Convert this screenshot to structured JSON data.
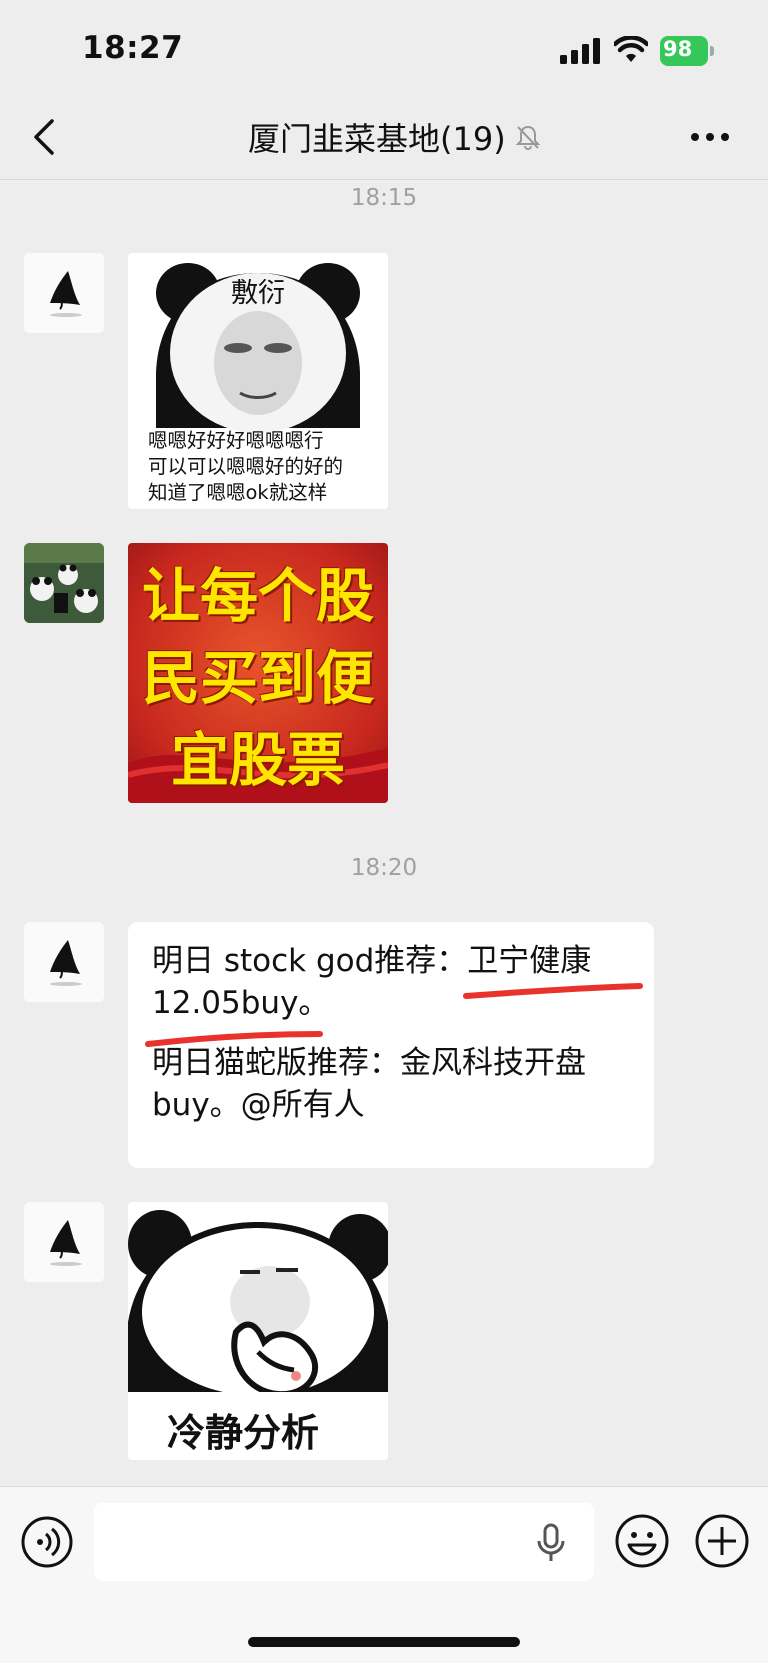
{
  "status_bar": {
    "time": "18:27",
    "battery": "98",
    "icons": [
      "signal-icon",
      "wifi-icon",
      "battery-icon"
    ]
  },
  "nav": {
    "title": "厦门韭菜基地(19)",
    "icons": [
      "back-icon",
      "mute-icon",
      "more-icon"
    ]
  },
  "chat": {
    "messages": [
      {
        "timestamp": "18:15",
        "sticker_top": "敷衍",
        "sticker_lines": [
          "嗯嗯好好好嗯嗯嗯行",
          "可以可以嗯嗯好的好的",
          "知道了嗯嗯ok就这样"
        ]
      },
      {
        "banner_lines": [
          "让每个股",
          "民买到便",
          "宜股票"
        ]
      },
      {
        "timestamp": "18:20",
        "text_p1_line1": "明日 stock god推荐：卫宁健康",
        "text_p1_line2": "12.05buy。",
        "text_p2_line1": "明日猫蛇版推荐：金风科技开盘",
        "text_p2_line2": "buy。@所有人",
        "annotation_color": "#e8322b"
      },
      {
        "sticker_caption": "冷静分析"
      }
    ]
  },
  "input_bar": {
    "placeholder": "",
    "icons": [
      "voice-icon",
      "mic-icon",
      "emoji-icon",
      "plus-icon"
    ]
  }
}
